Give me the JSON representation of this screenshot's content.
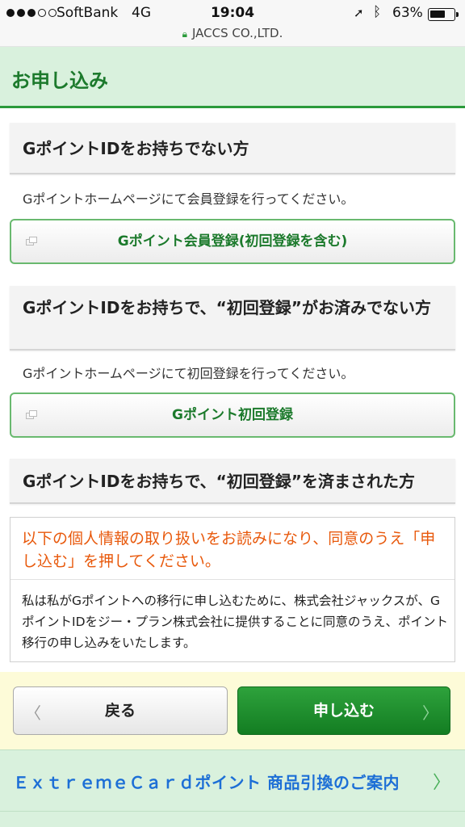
{
  "status_bar": {
    "carrier": "SoftBank",
    "network": "4G",
    "time": "19:04",
    "battery_percent": "63%",
    "battery_level": 0.63,
    "location_icon": "location-arrow-icon",
    "bluetooth_icon": "bluetooth-icon",
    "url": "JACCS CO.,LTD."
  },
  "header": {
    "title": "お申し込み"
  },
  "section1": {
    "heading": "GポイントIDをお持ちでない方",
    "description": "Gポイントホームページにて会員登録を行ってください。",
    "button_label": "Gポイント会員登録(初回登録を含む)"
  },
  "section2": {
    "heading": "GポイントIDをお持ちで、“初回登録”がお済みでない方",
    "description": "Gポイントホームページにて初回登録を行ってください。",
    "button_label": "Gポイント初回登録"
  },
  "section3": {
    "heading": "GポイントIDをお持ちで、“初回登録”を済まされた方"
  },
  "agreement": {
    "warning": "以下の個人情報の取り扱いをお読みになり、同意のうえ「申し込む」を押してください。",
    "text": "私は私がGポイントへの移行に申し込むために、株式会社ジャックスが、GポイントIDをジー・プラン株式会社に提供することに同意のうえ、ポイント移行の申し込みをいたします。"
  },
  "actions": {
    "back_label": "戻る",
    "apply_label": "申し込む"
  },
  "links": {
    "extreme_card": "ＥｘｔｒｅｍｅＣａｒｄポイント 商品引換のご案内"
  },
  "colors": {
    "brand_green": "#2a9a3a",
    "header_bg": "#d9f1dd",
    "warning": "#e8590c",
    "link_blue": "#1d6fd6"
  }
}
